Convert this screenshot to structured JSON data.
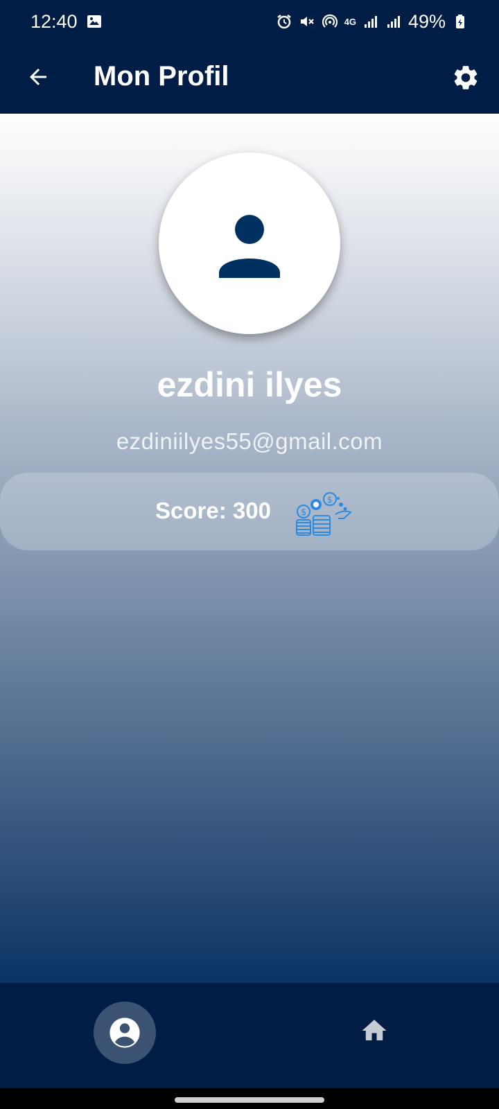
{
  "status_bar": {
    "time": "12:40",
    "battery": "49%",
    "network": "4G",
    "icons": [
      "image-icon",
      "alarm-icon",
      "mute-icon",
      "hotspot-icon",
      "signal-icon",
      "battery-icon"
    ]
  },
  "app_bar": {
    "title": "Mon Profil",
    "icons": [
      "back-arrow-icon",
      "gear-icon"
    ]
  },
  "profile": {
    "name": "ezdini ilyes",
    "email": "ezdiniilyes55@gmail.com",
    "score_label": "Score: 300",
    "avatar_icon": "person-icon",
    "score_icon": "coins-icon"
  },
  "bottom_nav": {
    "items": [
      {
        "icon": "account-circle-icon",
        "active": true
      },
      {
        "icon": "home-icon",
        "active": false
      }
    ]
  },
  "colors": {
    "primary_dark": "#001d45",
    "accent_blue": "#2c8be0",
    "active_nav_bg": "#3b5272"
  }
}
